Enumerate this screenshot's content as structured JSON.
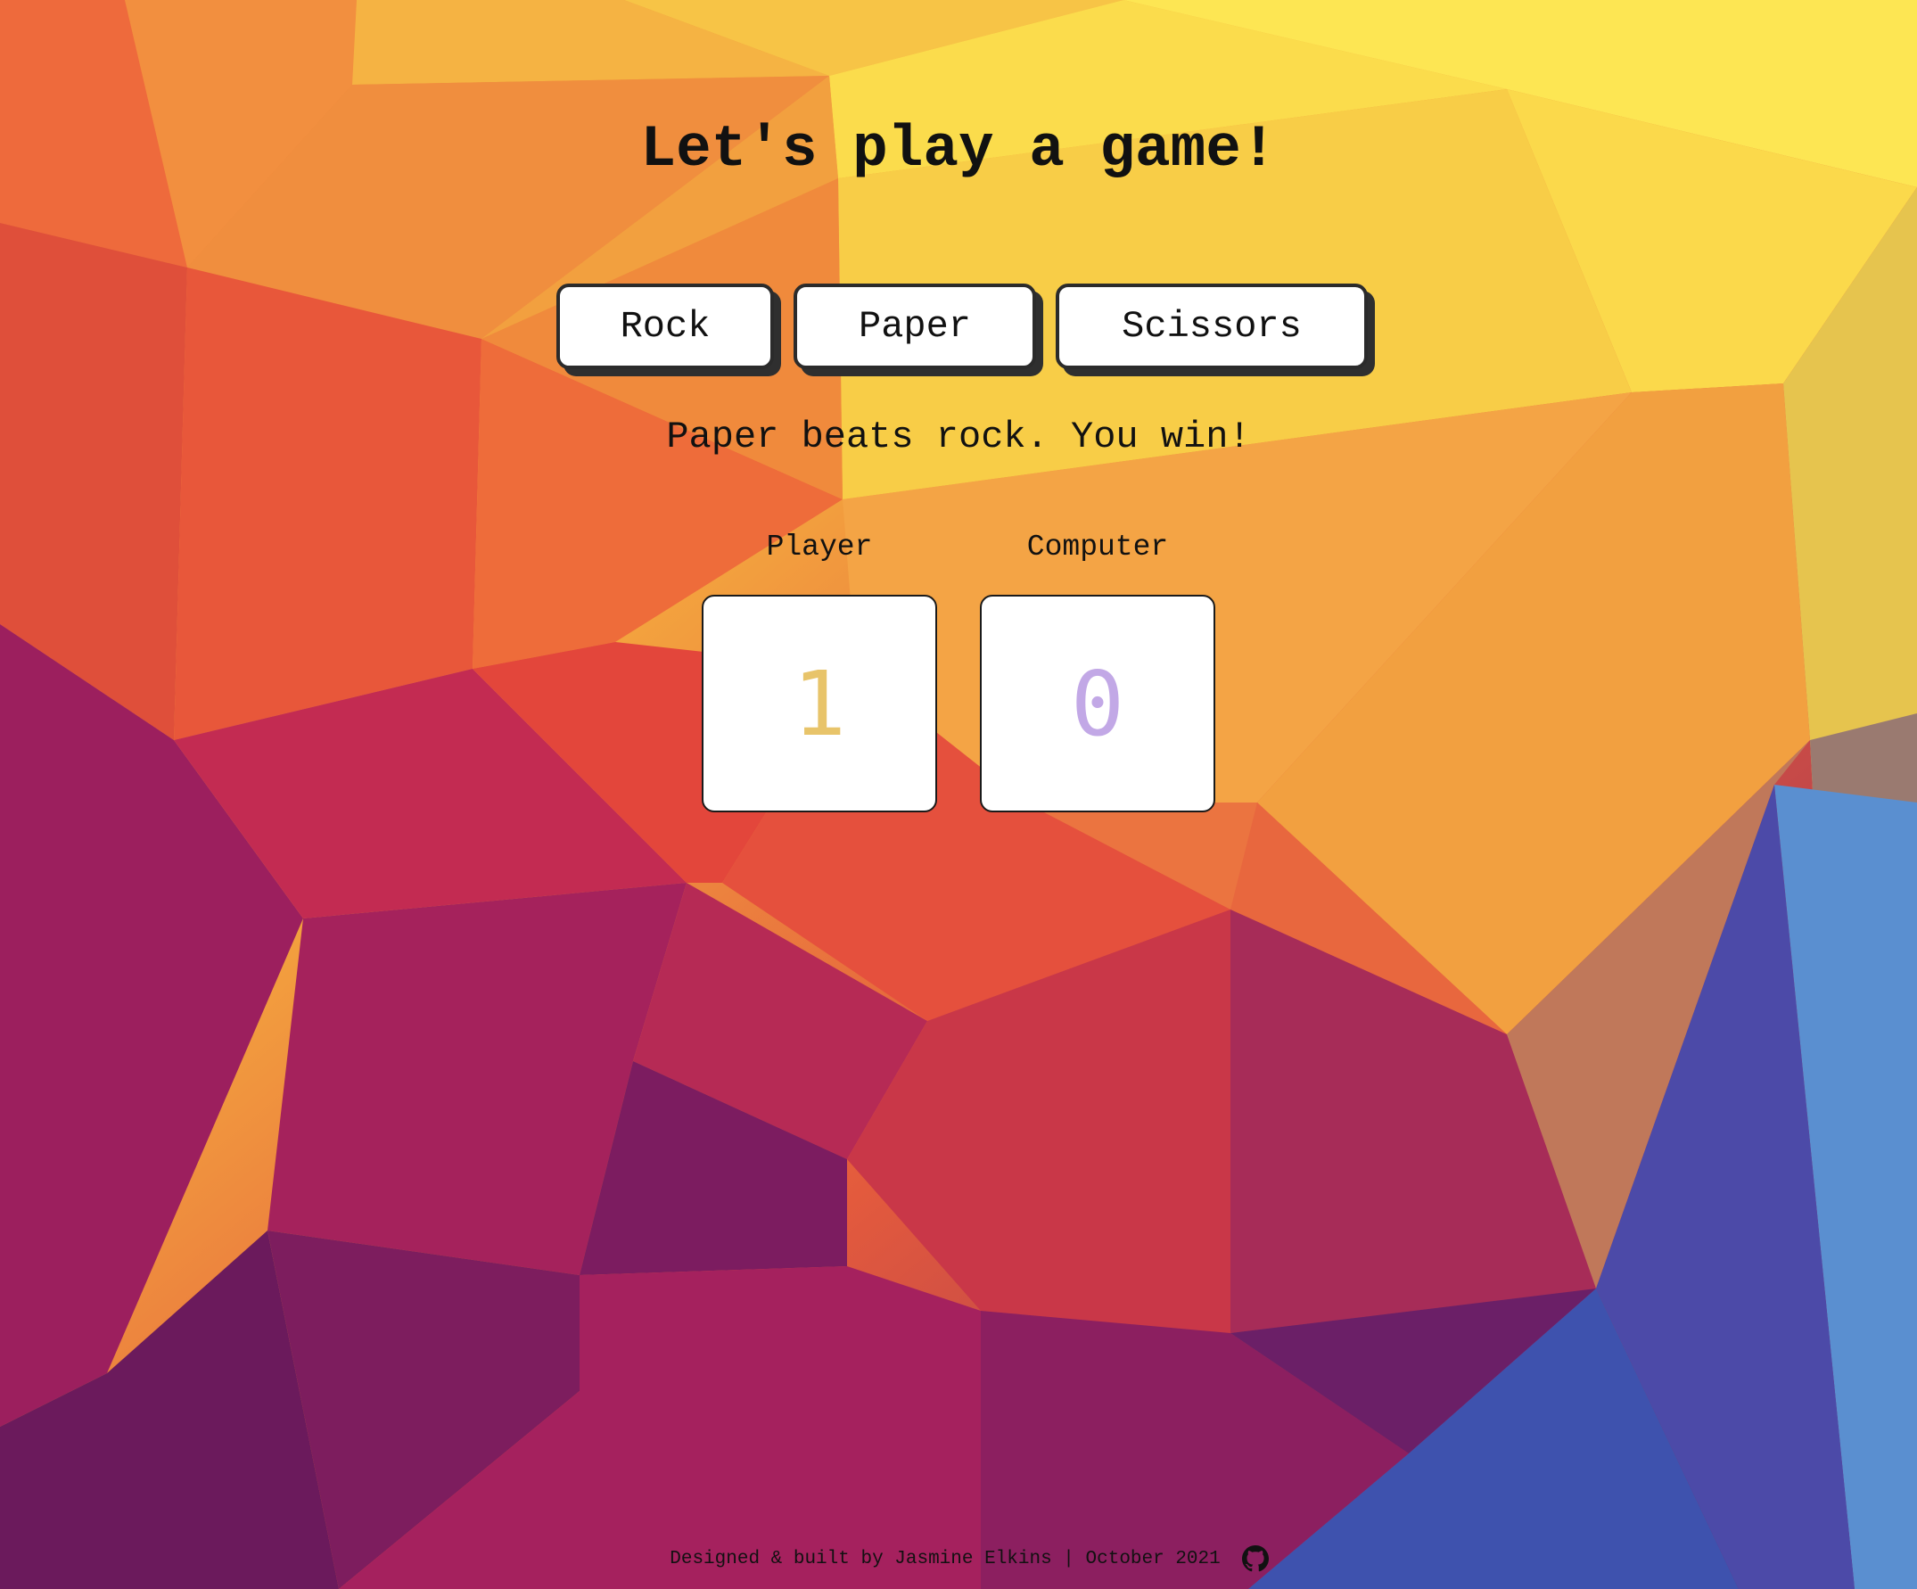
{
  "header": {
    "title": "Let's play a game!"
  },
  "choices": [
    {
      "label": "Rock"
    },
    {
      "label": "Paper"
    },
    {
      "label": "Scissors"
    }
  ],
  "result": {
    "message": "Paper beats rock. You win!"
  },
  "scoreboard": {
    "player": {
      "label": "Player",
      "score": "1",
      "color": "#e8c46a"
    },
    "computer": {
      "label": "Computer",
      "score": "0",
      "color": "#c2a8e6"
    }
  },
  "footer": {
    "text": "Designed & built by Jasmine Elkins | October 2021",
    "icon": "github-icon"
  },
  "theme": {
    "background": "low-poly gradient",
    "button_bg": "#ffffff",
    "button_shadow": "#2f2f2f"
  }
}
